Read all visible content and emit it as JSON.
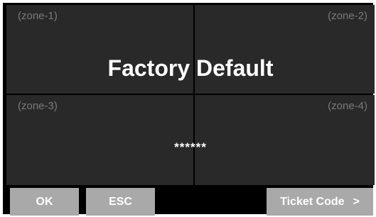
{
  "zones": [
    {
      "label": "(zone-1)"
    },
    {
      "label": "(zone-2)"
    },
    {
      "label": "(zone-3)"
    },
    {
      "label": "(zone-4)"
    }
  ],
  "title": "Factory Default",
  "password_mask": "******",
  "buttons": {
    "ok": "OK",
    "esc": "ESC",
    "ticket_code": "Ticket Code",
    "ticket_chevron": ">"
  },
  "colors": {
    "panel_background": "#000000",
    "zone_background": "#292929",
    "zone_label": "#7b7b7b",
    "button_background": "#a9a9a9",
    "text": "#ffffff"
  }
}
